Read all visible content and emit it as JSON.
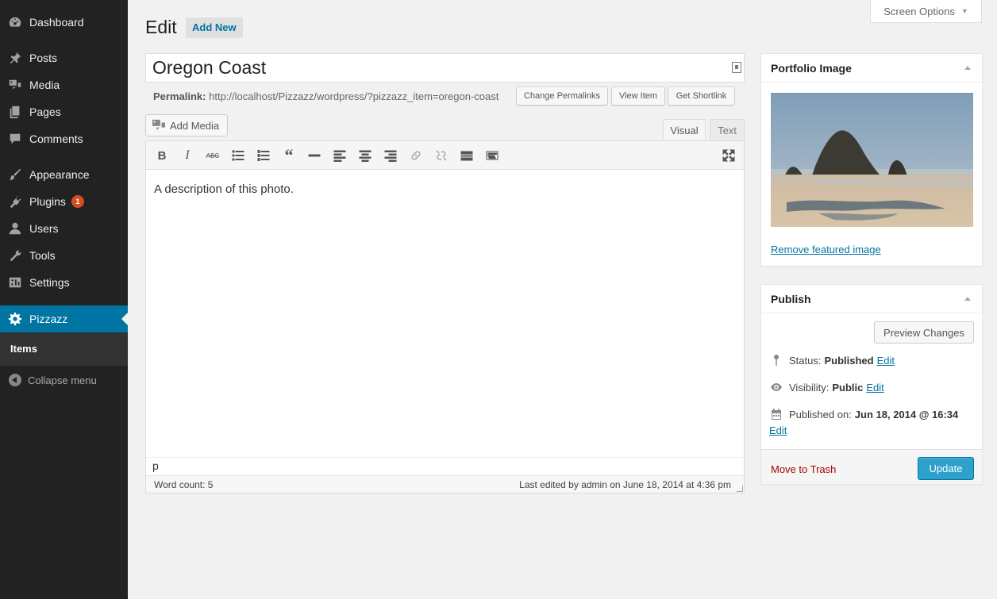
{
  "sidebar": {
    "items": [
      {
        "label": "Dashboard",
        "icon": "dashboard-icon"
      },
      {
        "label": "Posts",
        "icon": "pin-icon"
      },
      {
        "label": "Media",
        "icon": "media-icon"
      },
      {
        "label": "Pages",
        "icon": "pages-icon"
      },
      {
        "label": "Comments",
        "icon": "comment-icon"
      },
      {
        "label": "Appearance",
        "icon": "brush-icon"
      },
      {
        "label": "Plugins",
        "icon": "plug-icon",
        "badge": "1"
      },
      {
        "label": "Users",
        "icon": "user-icon"
      },
      {
        "label": "Tools",
        "icon": "wrench-icon"
      },
      {
        "label": "Settings",
        "icon": "settings-icon"
      },
      {
        "label": "Pizzazz",
        "icon": "gear-icon",
        "active": true
      }
    ],
    "submenu": {
      "label": "Items"
    },
    "collapse_label": "Collapse menu",
    "active_color": "#0074a2"
  },
  "header": {
    "title": "Edit",
    "add_new_label": "Add New",
    "screen_options_label": "Screen Options"
  },
  "post": {
    "title": "Oregon Coast",
    "permalink_label": "Permalink:",
    "permalink_url": "http://localhost/Pizzazz/wordpress/?pizzazz_item=oregon-coast",
    "change_permalinks_label": "Change Permalinks",
    "view_item_label": "View Item",
    "get_shortlink_label": "Get Shortlink"
  },
  "editor": {
    "add_media_label": "Add Media",
    "tab_visual": "Visual",
    "tab_text": "Text",
    "content": "A description of this photo.",
    "path": "p",
    "word_count": "Word count: 5",
    "last_edited": "Last edited by admin on June 18, 2014 at 4:36 pm",
    "toolbar_icons": [
      "bold-icon",
      "italic-icon",
      "strikethrough-icon",
      "bullet-list-icon",
      "numbered-list-icon",
      "blockquote-icon",
      "horizontal-rule-icon",
      "align-left-icon",
      "align-center-icon",
      "align-right-icon",
      "link-icon",
      "unlink-icon",
      "read-more-icon",
      "toolbar-toggle-icon",
      "fullscreen-icon"
    ]
  },
  "portfolio_image": {
    "title": "Portfolio Image",
    "remove_label": "Remove featured image"
  },
  "publish": {
    "title": "Publish",
    "preview_label": "Preview Changes",
    "status_label": "Status:",
    "status_value": "Published",
    "visibility_label": "Visibility:",
    "visibility_value": "Public",
    "published_on_label": "Published on:",
    "published_on_value": "Jun 18, 2014 @ 16:34",
    "edit_label": "Edit",
    "trash_label": "Move to Trash",
    "update_label": "Update",
    "update_color": "#2ea2cc"
  }
}
